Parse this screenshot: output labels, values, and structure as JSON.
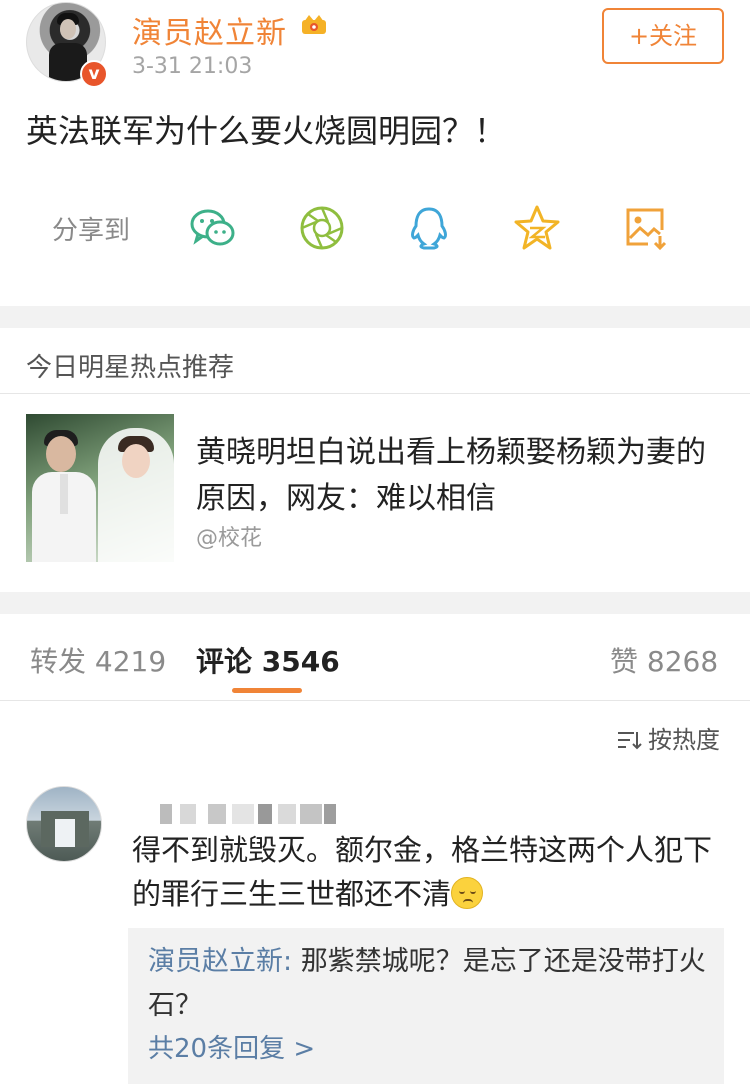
{
  "post": {
    "author": "演员赵立新",
    "time": "3-31 21:03",
    "follow_label": "+关注",
    "text": "英法联军为什么要火烧圆明园？！",
    "verified_mark": "v"
  },
  "share": {
    "label": "分享到",
    "icons": [
      "wechat-icon",
      "moments-icon",
      "qq-icon",
      "qzone-icon",
      "save-image-icon"
    ]
  },
  "hot": {
    "title": "今日明星热点推荐",
    "headline": "黄晓明坦白说出看上杨颖娶杨颖为妻的原因，网友：难以相信",
    "source": "@校花"
  },
  "tabs": {
    "repost_label": "转发",
    "repost_count": "4219",
    "comment_label": "评论",
    "comment_count": "3546",
    "like_label": "赞",
    "like_count": "8268"
  },
  "sort": {
    "label": "按热度"
  },
  "comment": {
    "text": "得不到就毁灭。额尔金，格兰特这两个人犯下的罪行三生三世都还不清",
    "reply_author": "演员赵立新:",
    "reply_text": " 那紫禁城呢？是忘了还是没带打火石？",
    "reply_more": "共20条回复 >"
  },
  "colors": {
    "accent": "#f08437",
    "link": "#5b7ea5",
    "separator": "#f2f2f2"
  }
}
